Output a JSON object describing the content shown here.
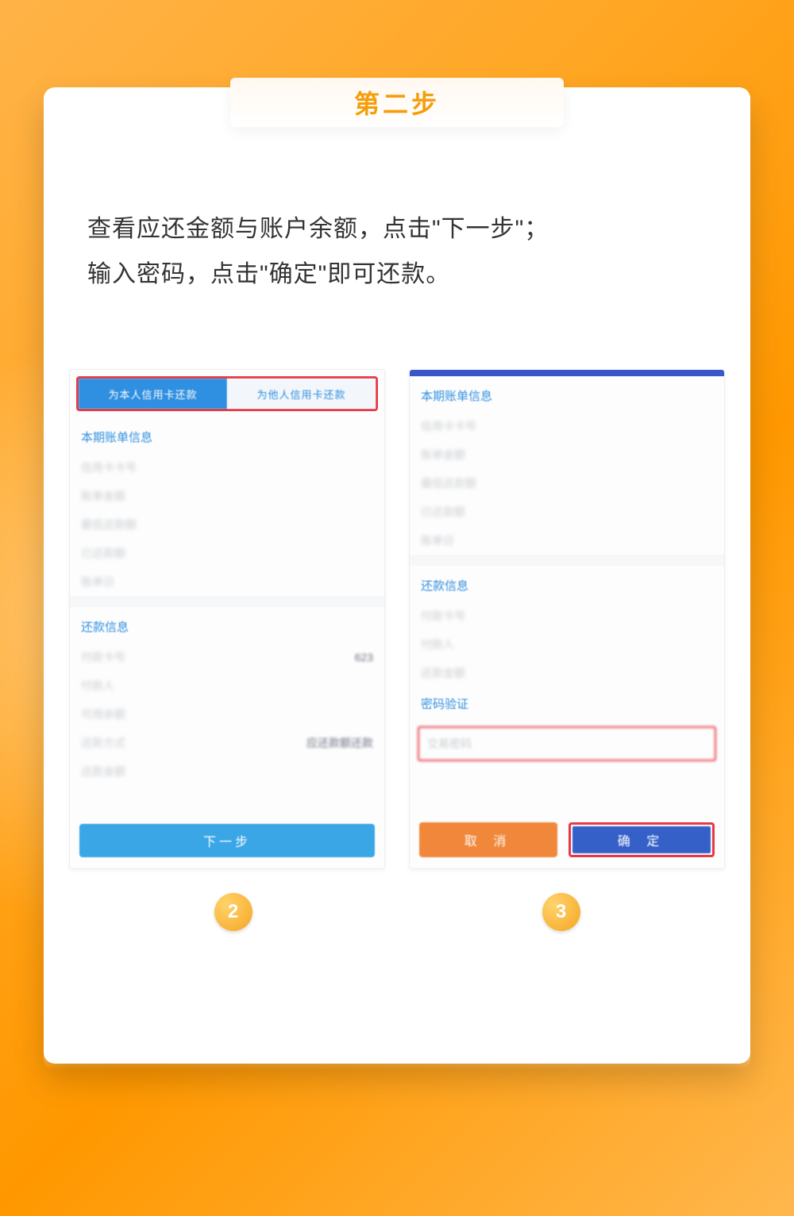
{
  "tab_title": "第二步",
  "instructions_line1": "查看应还金额与账户余额，点击\"下一步\"；",
  "instructions_line2": "输入密码，点击\"确定\"即可还款。",
  "left": {
    "tab_active": "为本人信用卡还款",
    "tab_inactive": "为他人信用卡还款",
    "section_bill": "本期账单信息",
    "rows_bill": [
      "信用卡卡号",
      "账单金额",
      "最低还款额",
      "已还款额",
      "账单日"
    ],
    "section_repay": "还款信息",
    "row_pay_card_label": "付款卡号",
    "row_pay_card_value": "623",
    "rows_repay": [
      "付款人",
      "可用余额"
    ],
    "row_method_label": "还款方式",
    "row_method_value": "应还款额还款",
    "row_amount": "还款金额",
    "next_btn": "下一步"
  },
  "right": {
    "section_bill": "本期账单信息",
    "rows_bill": [
      "信用卡卡号",
      "账单金额",
      "最低还款额",
      "已还款额",
      "账单日"
    ],
    "section_repay": "还款信息",
    "rows_repay": [
      "付款卡号",
      "付款人",
      "还款金额"
    ],
    "section_pw": "密码验证",
    "pw_placeholder": "交易密码",
    "cancel": "取 消",
    "confirm": "确 定"
  },
  "circle2": "2",
  "circle3": "3"
}
